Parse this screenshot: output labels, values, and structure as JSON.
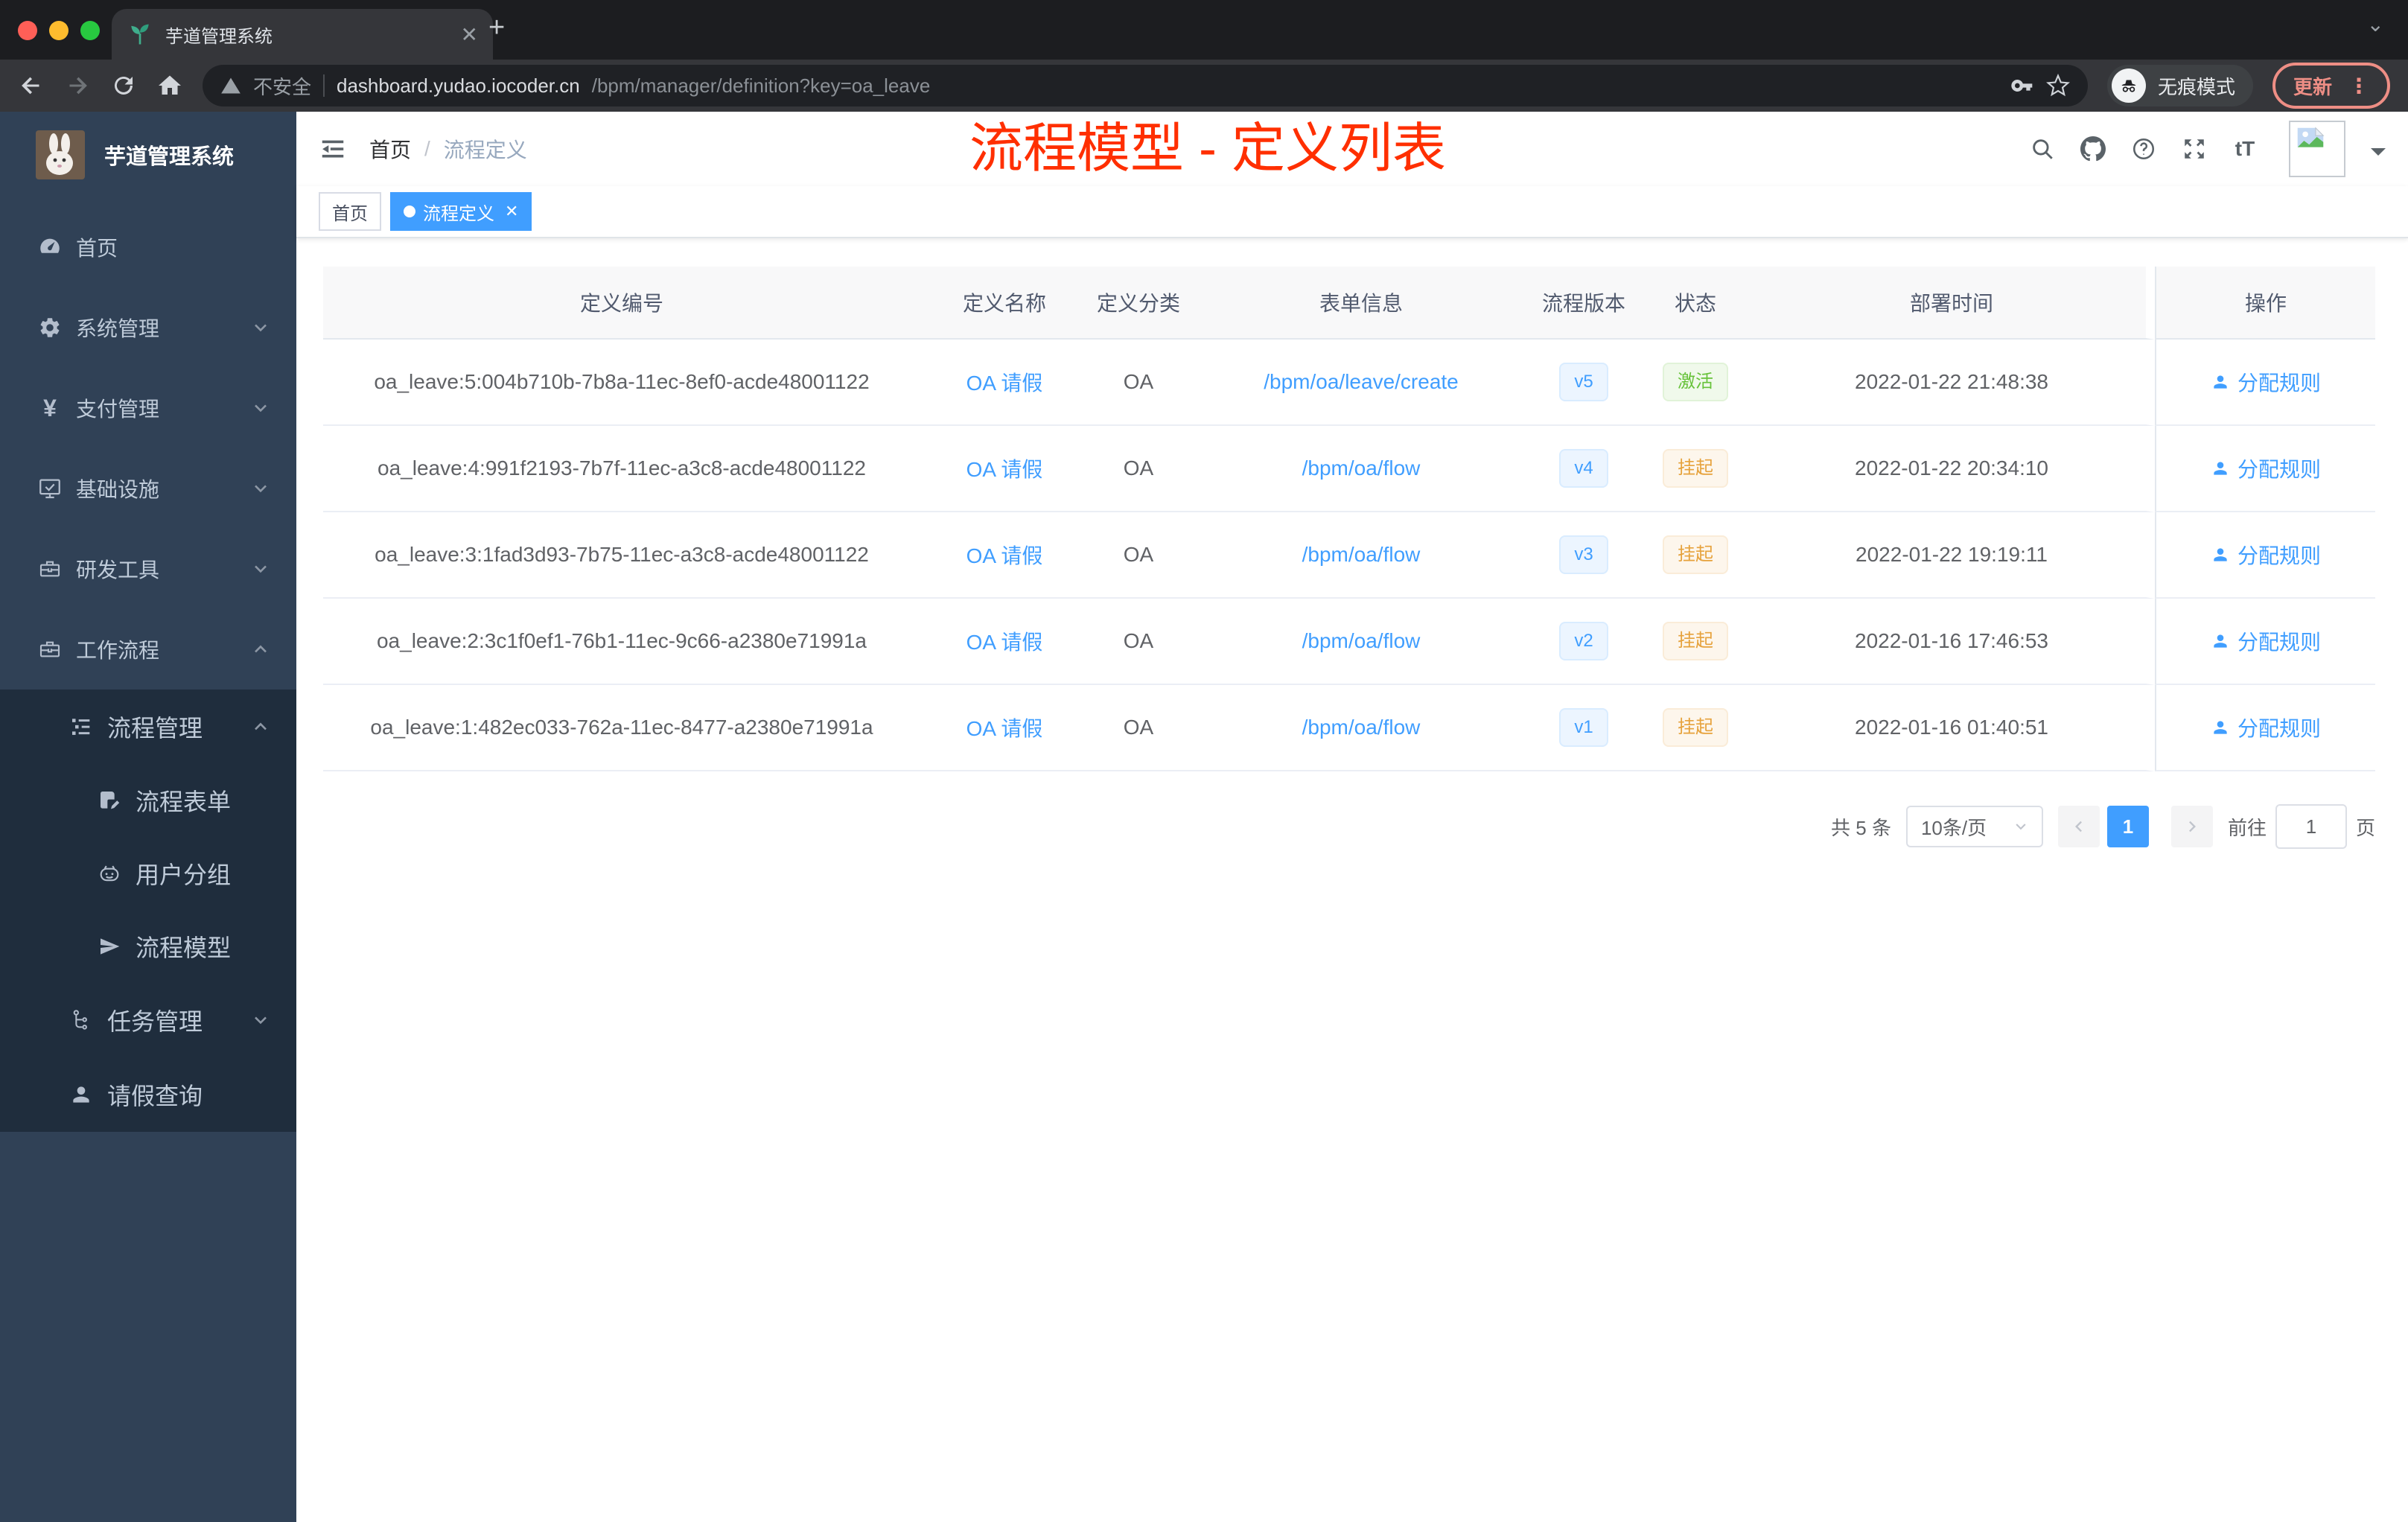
{
  "colors": {
    "accent": "#409eff",
    "success": "#67c23a",
    "warning": "#e6a23c",
    "annotation_red": "#ff2f00",
    "sidebar_bg": "#304156",
    "sidebar_submenu_bg": "#1f2d3d",
    "tag_active_bg": "#409eff",
    "traffic_close": "#ff5f57",
    "traffic_minimize": "#febc2e",
    "traffic_zoom": "#28c840"
  },
  "browser": {
    "tab_title": "芋道管理系统",
    "security_label": "不安全",
    "url_host": "dashboard.yudao.iocoder.cn",
    "url_path": "/bpm/manager/definition?key=oa_leave",
    "incognito_label": "无痕模式",
    "update_label": "更新"
  },
  "sidebar": {
    "logo_title": "芋道管理系统",
    "menu": [
      {
        "label": "首页"
      },
      {
        "label": "系统管理"
      },
      {
        "label": "支付管理"
      },
      {
        "label": "基础设施"
      },
      {
        "label": "研发工具"
      },
      {
        "label": "工作流程"
      }
    ],
    "workflow_menu": [
      {
        "label": "流程管理"
      },
      {
        "label": "流程表单"
      },
      {
        "label": "用户分组"
      },
      {
        "label": "流程模型"
      },
      {
        "label": "任务管理"
      },
      {
        "label": "请假查询"
      }
    ]
  },
  "header": {
    "breadcrumb_home": "首页",
    "breadcrumb_separator": "/",
    "breadcrumb_current": "流程定义",
    "font_size_icon_text": "tT",
    "annotation": "流程模型 - 定义列表"
  },
  "tags": {
    "home": "首页",
    "current": "流程定义"
  },
  "table": {
    "columns": [
      "定义编号",
      "定义名称",
      "定义分类",
      "表单信息",
      "流程版本",
      "状态",
      "部署时间",
      "操作"
    ],
    "rows": [
      {
        "id": "oa_leave:5:004b710b-7b8a-11ec-8ef0-acde48001122",
        "name": "OA 请假",
        "category": "OA",
        "form": "/bpm/oa/leave/create",
        "version": "v5",
        "status": "激活",
        "deployed_at": "2022-01-22 21:48:38",
        "action": "分配规则"
      },
      {
        "id": "oa_leave:4:991f2193-7b7f-11ec-a3c8-acde48001122",
        "name": "OA 请假",
        "category": "OA",
        "form": "/bpm/oa/flow",
        "version": "v4",
        "status": "挂起",
        "deployed_at": "2022-01-22 20:34:10",
        "action": "分配规则"
      },
      {
        "id": "oa_leave:3:1fad3d93-7b75-11ec-a3c8-acde48001122",
        "name": "OA 请假",
        "category": "OA",
        "form": "/bpm/oa/flow",
        "version": "v3",
        "status": "挂起",
        "deployed_at": "2022-01-22 19:19:11",
        "action": "分配规则"
      },
      {
        "id": "oa_leave:2:3c1f0ef1-76b1-11ec-9c66-a2380e71991a",
        "name": "OA 请假",
        "category": "OA",
        "form": "/bpm/oa/flow",
        "version": "v2",
        "status": "挂起",
        "deployed_at": "2022-01-16 17:46:53",
        "action": "分配规则"
      },
      {
        "id": "oa_leave:1:482ec033-762a-11ec-8477-a2380e71991a",
        "name": "OA 请假",
        "category": "OA",
        "form": "/bpm/oa/flow",
        "version": "v1",
        "status": "挂起",
        "deployed_at": "2022-01-16 01:40:51",
        "action": "分配规则"
      }
    ]
  },
  "pagination": {
    "total": "共 5 条",
    "page_size": "10条/页",
    "page": "1",
    "goto_prefix": "前往",
    "goto_value": "1",
    "goto_suffix": "页"
  }
}
